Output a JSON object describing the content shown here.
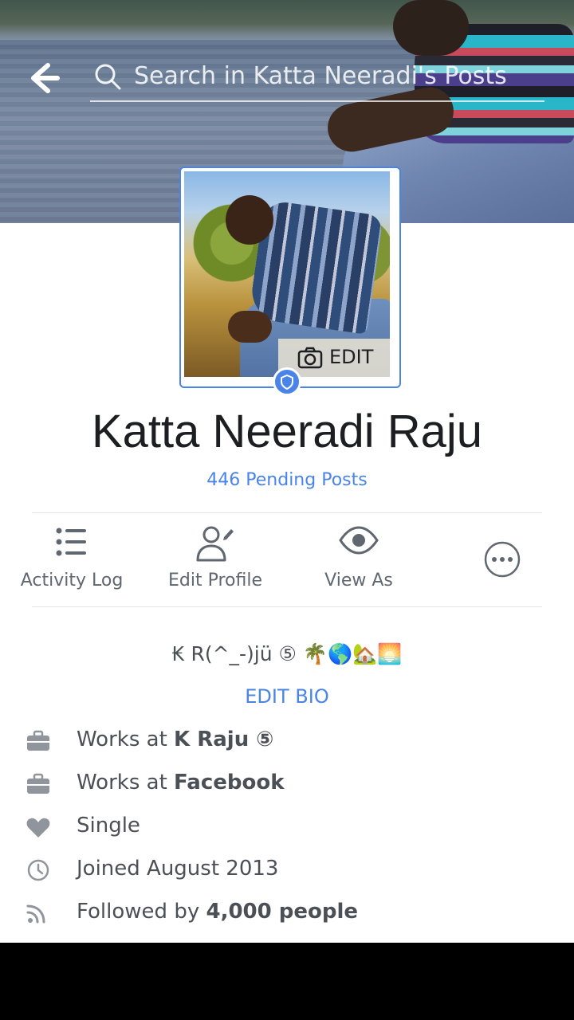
{
  "header": {
    "search_placeholder": "Search in Katta Neeradi's Posts"
  },
  "profile": {
    "name": "Katta Neeradi Raju",
    "pending_posts": "446 Pending Posts",
    "edit_photo_label": "EDIT"
  },
  "actions": [
    {
      "label": "Activity Log",
      "icon": "list-icon"
    },
    {
      "label": "Edit Profile",
      "icon": "edit-person-icon"
    },
    {
      "label": "View As",
      "icon": "eye-icon"
    },
    {
      "label": "",
      "icon": "more-icon"
    }
  ],
  "bio": {
    "text": "₭ R(^_-)jü ⑤ 🌴🌎🏡🌅",
    "edit_label": "EDIT BIO"
  },
  "intro": [
    {
      "icon": "briefcase-icon",
      "prefix": "Works at ",
      "bold": "K Raju ⑤"
    },
    {
      "icon": "briefcase-icon",
      "prefix": "Works at ",
      "bold": "Facebook"
    },
    {
      "icon": "heart-icon",
      "prefix": "Single",
      "bold": ""
    },
    {
      "icon": "clock-icon",
      "prefix": "Joined August 2013",
      "bold": ""
    },
    {
      "icon": "rss-icon",
      "prefix": "Followed by ",
      "bold": "4,000 people"
    }
  ],
  "colors": {
    "accent": "#4a84e8",
    "text": "#4b4f56",
    "secondary": "#606770"
  }
}
